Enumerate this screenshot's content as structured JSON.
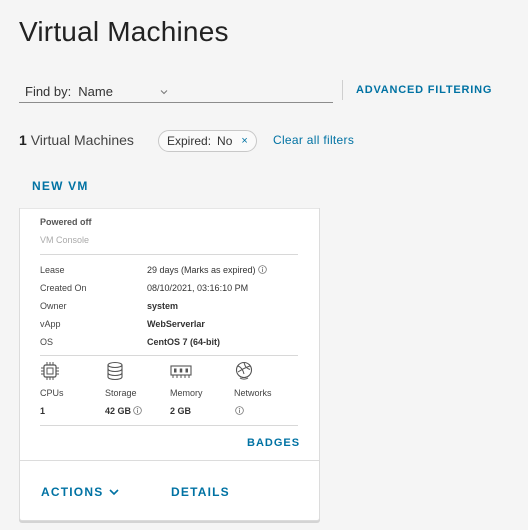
{
  "page": {
    "title": "Virtual Machines"
  },
  "search": {
    "find_by_label": "Find by:",
    "find_by_value": "Name",
    "advanced_filtering": "ADVANCED FILTERING"
  },
  "summary": {
    "count": "1",
    "count_label": "Virtual Machines"
  },
  "filter_chip": {
    "key": "Expired:",
    "value": "No",
    "remove_glyph": "×"
  },
  "clear_filters": "Clear all filters",
  "new_vm": "NEW VM",
  "vm": {
    "state": "Powered off",
    "console": "VM Console",
    "fields": [
      {
        "label": "Lease",
        "value": "29 days (Marks as expired)"
      },
      {
        "label": "Created On",
        "value": "08/10/2021, 03:16:10 PM"
      },
      {
        "label": "Owner",
        "value": "system"
      },
      {
        "label": "vApp",
        "value": "WebServerlar"
      },
      {
        "label": "OS",
        "value": "CentOS 7 (64-bit)"
      }
    ],
    "resources": [
      {
        "icon": "cpu-icon",
        "label": "CPUs",
        "value": "1"
      },
      {
        "icon": "storage-icon",
        "label": "Storage",
        "value": "42 GB"
      },
      {
        "icon": "memory-icon",
        "label": "Memory",
        "value": "2 GB"
      },
      {
        "icon": "network-icon",
        "label": "Networks",
        "value": ""
      }
    ],
    "badges": "BADGES",
    "actions": "ACTIONS",
    "details": "DETAILS"
  },
  "colors": {
    "accent": "#0072a3",
    "background": "#f5f5f5",
    "card": "#ffffff"
  }
}
